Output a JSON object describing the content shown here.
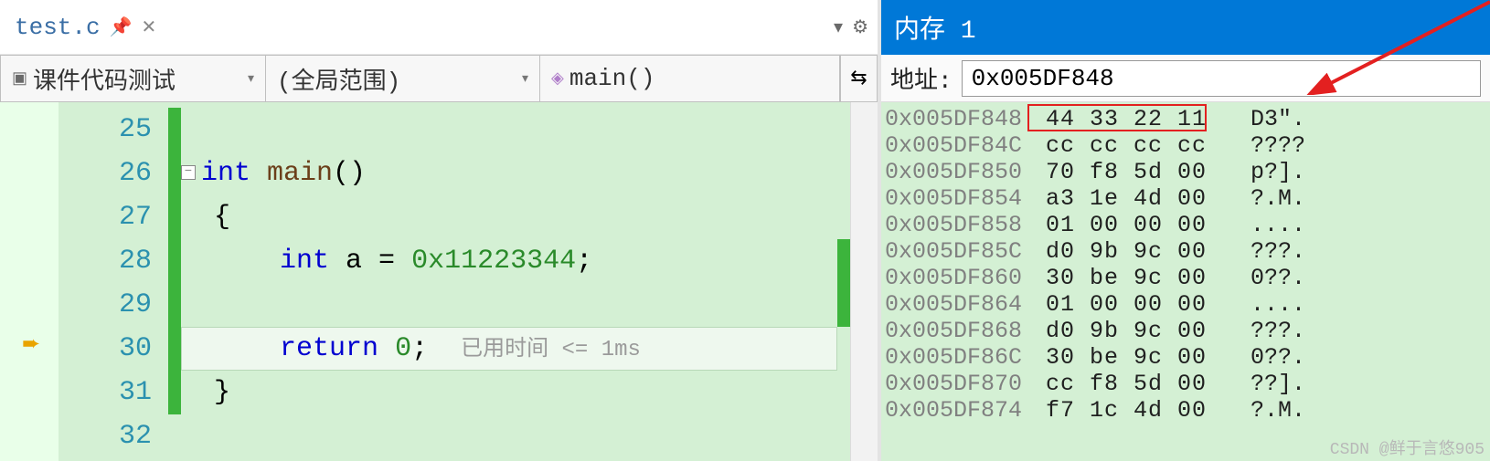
{
  "tab": {
    "filename": "test.c"
  },
  "nav": {
    "scope1": "课件代码测试",
    "scope2": "(全局范围)",
    "scope3": "main()"
  },
  "code": {
    "lines": {
      "25": "",
      "26": "int main()",
      "27": "{",
      "28": "    int a = 0x11223344;",
      "29": "",
      "30": "    return 0;",
      "31": "}",
      "32": ""
    },
    "timing_hint": "已用时间 <= 1ms",
    "current_exec_line": 30
  },
  "memory": {
    "title": "内存 1",
    "addr_label": "地址:",
    "addr_value": "0x005DF848",
    "rows": [
      {
        "addr": "0x005DF848",
        "bytes": "44 33 22 11",
        "ascii": "D3\"."
      },
      {
        "addr": "0x005DF84C",
        "bytes": "cc cc cc cc",
        "ascii": "????"
      },
      {
        "addr": "0x005DF850",
        "bytes": "70 f8 5d 00",
        "ascii": "p?]."
      },
      {
        "addr": "0x005DF854",
        "bytes": "a3 1e 4d 00",
        "ascii": "?.M."
      },
      {
        "addr": "0x005DF858",
        "bytes": "01 00 00 00",
        "ascii": "...."
      },
      {
        "addr": "0x005DF85C",
        "bytes": "d0 9b 9c 00",
        "ascii": "???."
      },
      {
        "addr": "0x005DF860",
        "bytes": "30 be 9c 00",
        "ascii": "0??."
      },
      {
        "addr": "0x005DF864",
        "bytes": "01 00 00 00",
        "ascii": "...."
      },
      {
        "addr": "0x005DF868",
        "bytes": "d0 9b 9c 00",
        "ascii": "???."
      },
      {
        "addr": "0x005DF86C",
        "bytes": "30 be 9c 00",
        "ascii": "0??."
      },
      {
        "addr": "0x005DF870",
        "bytes": "cc f8 5d 00",
        "ascii": "??]."
      },
      {
        "addr": "0x005DF874",
        "bytes": "f7 1c 4d 00",
        "ascii": "?.M."
      }
    ]
  },
  "watermark": "CSDN @鲜于言悠905"
}
